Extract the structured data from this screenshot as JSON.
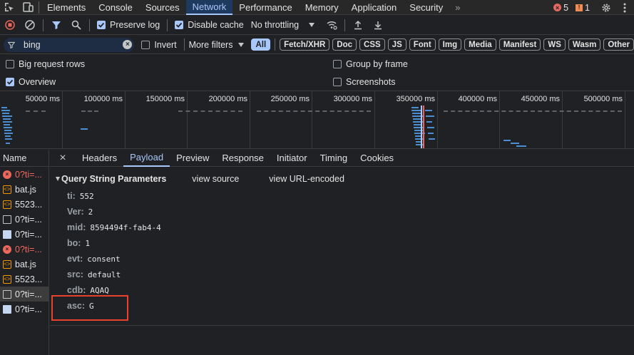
{
  "tabs": [
    "Elements",
    "Console",
    "Sources",
    "Network",
    "Performance",
    "Memory",
    "Application",
    "Security"
  ],
  "more_tabs": "»",
  "error_count": "5",
  "warning_count": "1",
  "toolbar": {
    "preserve_log": "Preserve log",
    "disable_cache": "Disable cache",
    "throttling": "No throttling"
  },
  "filter": {
    "value": "bing",
    "invert": "Invert",
    "more_filters": "More filters",
    "types": [
      "All",
      "Fetch/XHR",
      "Doc",
      "CSS",
      "JS",
      "Font",
      "Img",
      "Media",
      "Manifest",
      "WS",
      "Wasm",
      "Other"
    ]
  },
  "options": {
    "big_rows": "Big request rows",
    "group_by_frame": "Group by frame",
    "overview": "Overview",
    "screenshots": "Screenshots"
  },
  "timeline_ticks": [
    "50000 ms",
    "100000 ms",
    "150000 ms",
    "200000 ms",
    "250000 ms",
    "300000 ms",
    "350000 ms",
    "400000 ms",
    "450000 ms",
    "500000 ms"
  ],
  "list": {
    "header": "Name",
    "rows": [
      {
        "name": "0?ti=...",
        "kind": "err"
      },
      {
        "name": "bat.js",
        "kind": "js"
      },
      {
        "name": "5523...",
        "kind": "js"
      },
      {
        "name": "0?ti=...",
        "kind": "doc"
      },
      {
        "name": "0?ti=...",
        "kind": "file"
      },
      {
        "name": "0?ti=...",
        "kind": "err"
      },
      {
        "name": "bat.js",
        "kind": "js"
      },
      {
        "name": "5523...",
        "kind": "js"
      },
      {
        "name": "0?ti=...",
        "kind": "doc"
      },
      {
        "name": "0?ti=...",
        "kind": "file"
      }
    ]
  },
  "detail": {
    "close": "×",
    "tabs": [
      "Headers",
      "Payload",
      "Preview",
      "Response",
      "Initiator",
      "Timing",
      "Cookies"
    ],
    "section_title": "Query String Parameters",
    "view_source": "view source",
    "view_url_encoded": "view URL-encoded",
    "params": [
      {
        "key": "ti:",
        "value": "552"
      },
      {
        "key": "Ver:",
        "value": "2"
      },
      {
        "key": "mid:",
        "value": "8594494f-fab4-4"
      },
      {
        "key": "bo:",
        "value": "1"
      },
      {
        "key": "evt:",
        "value": "consent"
      },
      {
        "key": "src:",
        "value": "default"
      },
      {
        "key": "cdb:",
        "value": "AQAQ"
      },
      {
        "key": "asc:",
        "value": "G"
      }
    ]
  },
  "colors": {
    "accent": "#a8c7fa",
    "error": "#ee675c",
    "highlight_box": "#e8412e"
  }
}
